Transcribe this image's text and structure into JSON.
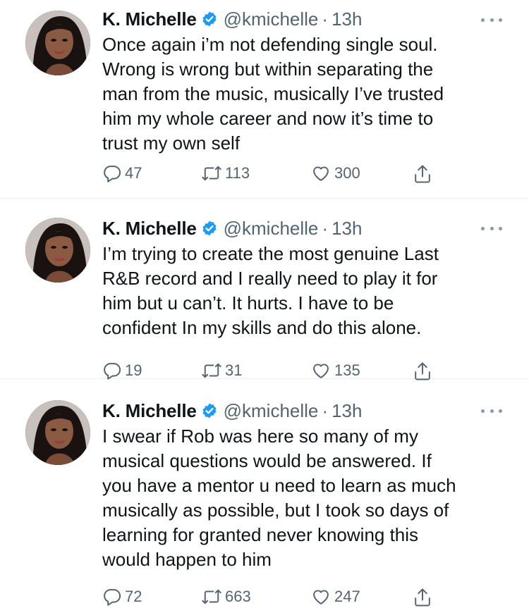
{
  "colors": {
    "text": "#0f1419",
    "secondary": "#536471",
    "verified": "#1d9bf0",
    "divider": "#e6ecf0"
  },
  "tweets": [
    {
      "author": {
        "name": "K. Michelle",
        "handle": "@kmichelle",
        "verified": true
      },
      "time": "13h",
      "text": "Once again i’m not defending single soul.\nWrong is wrong but within separating the\nman from the music, musically I’ve trusted\nhim my whole career and now it’s time to\ntrust my own self",
      "replies": "47",
      "retweets": "113",
      "likes": "300"
    },
    {
      "author": {
        "name": "K. Michelle",
        "handle": "@kmichelle",
        "verified": true
      },
      "time": "13h",
      "text": "I’m trying to create the most genuine Last\nR&B record and I really need to play it for\nhim but u can’t. It hurts. I have to be\nconfident In my skills and do this alone.",
      "replies": "19",
      "retweets": "31",
      "likes": "135"
    },
    {
      "author": {
        "name": "K. Michelle",
        "handle": "@kmichelle",
        "verified": true
      },
      "time": "13h",
      "text": "I swear if Rob was here so many of my\nmusical questions would be answered. If\nyou have a mentor u need to learn as much\nmusically as possible, but I took so days of\nlearning for granted never knowing this\nwould happen to him",
      "replies": "72",
      "retweets": "663",
      "likes": "247"
    }
  ],
  "separator": "·",
  "icons": {
    "reply": "speech-bubble-icon",
    "retweet": "retweet-arrows-icon",
    "like": "heart-icon",
    "share": "share-upload-icon",
    "more": "ellipsis-icon",
    "verified": "verified-badge-icon"
  }
}
